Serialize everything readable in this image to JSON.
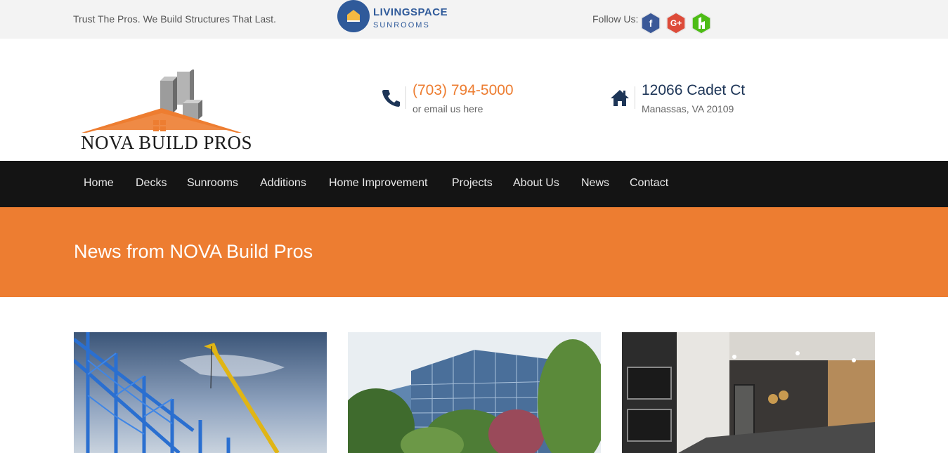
{
  "topbar": {
    "tagline": "Trust The Pros. We Build Structures That Last.",
    "partner_logo": {
      "brand": "LIVINGSPACE",
      "sub": "SUNROOMS"
    },
    "follow_label": "Follow Us:",
    "social": [
      {
        "icon": "facebook-icon",
        "label": "f",
        "color": "#3b5998"
      },
      {
        "icon": "google-plus-icon",
        "label": "G+",
        "color": "#dd4b39"
      },
      {
        "icon": "houzz-icon",
        "label": "h",
        "color": "#4dbc15"
      }
    ]
  },
  "header": {
    "logo_text": "NOVA BUILD PROS",
    "phone": {
      "number": "(703) 794-5000",
      "email_text": "or email us here"
    },
    "address": {
      "street": "12066 Cadet Ct",
      "city": "Manassas, VA 20109"
    }
  },
  "nav": {
    "items": [
      "Home",
      "Decks",
      "Sunrooms",
      "Additions",
      "Home Improvement",
      "Projects",
      "About Us",
      "News",
      "Contact"
    ]
  },
  "banner": {
    "title": "News from NOVA Build Pros"
  },
  "colors": {
    "accent": "#ed7d31",
    "navy": "#1d3557",
    "nav_bg": "#141414",
    "topbar_bg": "#f3f3f3"
  },
  "cards": [
    {
      "image": "steel-frame-construction-crane-photo"
    },
    {
      "image": "glass-office-building-trees-photo"
    },
    {
      "image": "modern-kitchen-interior-photo"
    }
  ]
}
